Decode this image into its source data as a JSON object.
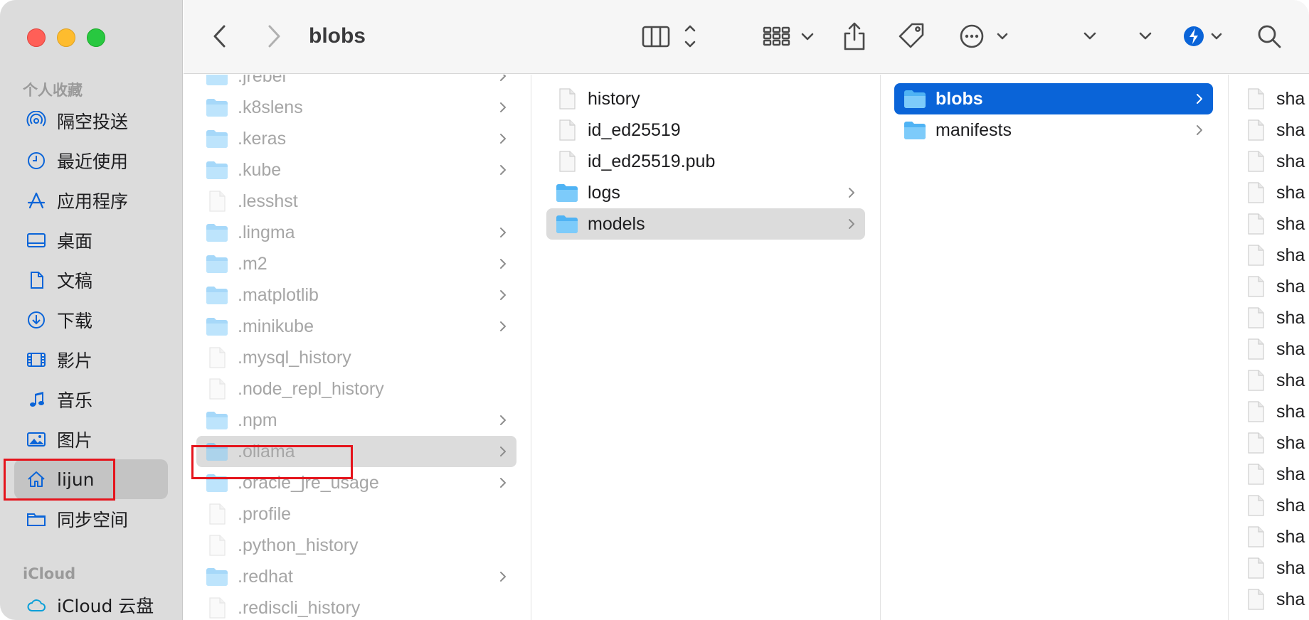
{
  "window": {
    "title": "blobs"
  },
  "sidebar": {
    "favorites_header": "个人收藏",
    "icloud_header": "iCloud",
    "items": [
      {
        "label": "隔空投送",
        "icon": "airdrop-icon"
      },
      {
        "label": "最近使用",
        "icon": "clock-icon"
      },
      {
        "label": "应用程序",
        "icon": "applications-icon"
      },
      {
        "label": "桌面",
        "icon": "desktop-icon"
      },
      {
        "label": "文稿",
        "icon": "document-icon"
      },
      {
        "label": "下载",
        "icon": "download-icon"
      },
      {
        "label": "影片",
        "icon": "film-icon"
      },
      {
        "label": "音乐",
        "icon": "music-icon"
      },
      {
        "label": "图片",
        "icon": "photo-icon"
      },
      {
        "label": "lijun",
        "icon": "home-icon",
        "selected": true
      },
      {
        "label": "同步空间",
        "icon": "folder-icon"
      }
    ],
    "icloud_items": [
      {
        "label": "iCloud 云盘",
        "icon": "cloud-icon"
      }
    ]
  },
  "toolbar": {
    "back": "back-icon",
    "forward": "forward-icon",
    "view": "column-view-icon",
    "group": "grid-group-icon",
    "share": "share-icon",
    "tag": "tag-icon",
    "more": "ellipsis-icon",
    "search": "search-icon",
    "accent": "#0a64d8"
  },
  "columns": {
    "col1": [
      {
        "name": ".jrebel",
        "type": "folder"
      },
      {
        "name": ".k8slens",
        "type": "folder"
      },
      {
        "name": ".keras",
        "type": "folder"
      },
      {
        "name": ".kube",
        "type": "folder"
      },
      {
        "name": ".lesshst",
        "type": "file"
      },
      {
        "name": ".lingma",
        "type": "folder"
      },
      {
        "name": ".m2",
        "type": "folder"
      },
      {
        "name": ".matplotlib",
        "type": "folder"
      },
      {
        "name": ".minikube",
        "type": "folder"
      },
      {
        "name": ".mysql_history",
        "type": "file"
      },
      {
        "name": ".node_repl_history",
        "type": "file"
      },
      {
        "name": ".npm",
        "type": "folder"
      },
      {
        "name": ".ollama",
        "type": "folder",
        "selected": true
      },
      {
        "name": ".oracle_jre_usage",
        "type": "folder"
      },
      {
        "name": ".profile",
        "type": "file"
      },
      {
        "name": ".python_history",
        "type": "file"
      },
      {
        "name": ".redhat",
        "type": "folder"
      },
      {
        "name": ".rediscli_history",
        "type": "file"
      }
    ],
    "col2": [
      {
        "name": "history",
        "type": "file"
      },
      {
        "name": "id_ed25519",
        "type": "file"
      },
      {
        "name": "id_ed25519.pub",
        "type": "file"
      },
      {
        "name": "logs",
        "type": "folder"
      },
      {
        "name": "models",
        "type": "folder",
        "selected": true
      }
    ],
    "col3": [
      {
        "name": "blobs",
        "type": "folder",
        "selected": true
      },
      {
        "name": "manifests",
        "type": "folder"
      }
    ],
    "col4_label": "sha",
    "col4_count": 17
  }
}
